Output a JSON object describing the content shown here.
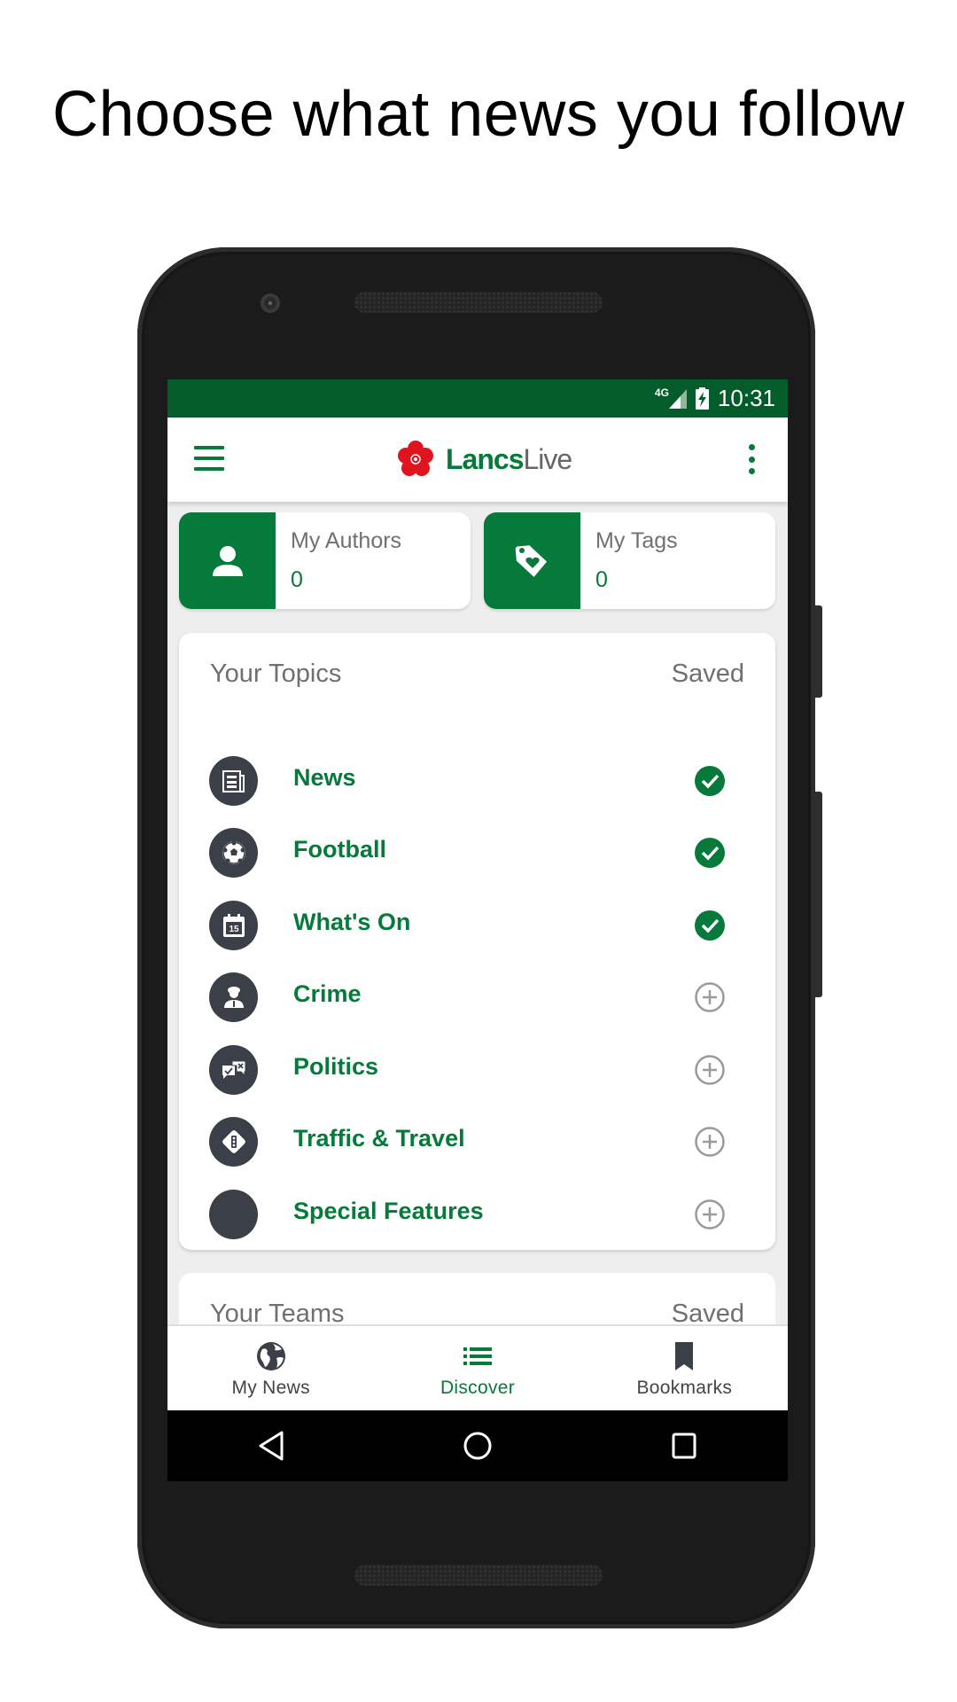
{
  "headline": "Choose what news you follow",
  "status_bar": {
    "network": "4G",
    "signal_icon": "cell-signal-icon",
    "battery_icon": "battery-charging-icon",
    "time": "10:31"
  },
  "app_bar": {
    "menu_icon": "hamburger-menu-icon",
    "logo_icon": "lancashire-rose-icon",
    "logo_bold": "Lancs",
    "logo_light": "Live",
    "more_icon": "more-vert-icon"
  },
  "summary_cards": [
    {
      "title": "My Authors",
      "count": "0",
      "icon": "person-icon"
    },
    {
      "title": "My Tags",
      "count": "0",
      "icon": "tag-heart-icon"
    }
  ],
  "topics": {
    "title": "Your Topics",
    "status_header": "Saved",
    "items": [
      {
        "label": "News",
        "icon": "newspaper-icon",
        "saved": true
      },
      {
        "label": "Football",
        "icon": "football-icon",
        "saved": true
      },
      {
        "label": "What's On",
        "icon": "calendar-icon",
        "saved": true
      },
      {
        "label": "Crime",
        "icon": "police-officer-icon",
        "saved": false
      },
      {
        "label": "Politics",
        "icon": "vote-chat-icon",
        "saved": false
      },
      {
        "label": "Traffic & Travel",
        "icon": "traffic-light-icon",
        "saved": false
      },
      {
        "label": "Special Features",
        "icon": "blank-circle-icon",
        "saved": false
      }
    ]
  },
  "teams": {
    "title": "Your Teams",
    "status_header": "Saved"
  },
  "bottom_nav": {
    "items": [
      {
        "label": "My News",
        "icon": "globe-icon",
        "active": false
      },
      {
        "label": "Discover",
        "icon": "list-icon",
        "active": true
      },
      {
        "label": "Bookmarks",
        "icon": "bookmark-icon",
        "active": false
      }
    ]
  },
  "system_nav": {
    "back": "back-icon",
    "home": "home-icon",
    "recents": "recents-icon"
  },
  "colors": {
    "brand_green": "#067a3a",
    "status_bar_green": "#035c2a",
    "icon_circle": "#3b3f47",
    "logo_red": "#e0141e",
    "muted_text": "#707070"
  }
}
